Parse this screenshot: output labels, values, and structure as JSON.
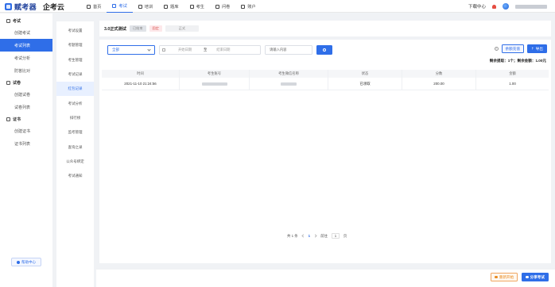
{
  "brand": {
    "logo_text": "赋考器",
    "sub_text": "企考云"
  },
  "nav": [
    {
      "label": "首页",
      "icon": "home-icon",
      "active": false
    },
    {
      "label": "考试",
      "icon": "exam-icon",
      "active": true
    },
    {
      "label": "培训",
      "icon": "training-icon",
      "active": false
    },
    {
      "label": "题库",
      "icon": "question-bank-icon",
      "active": false
    },
    {
      "label": "考生",
      "icon": "student-icon",
      "active": false
    },
    {
      "label": "问卷",
      "icon": "survey-icon",
      "active": false
    },
    {
      "label": "账户",
      "icon": "account-icon",
      "active": false
    }
  ],
  "topbar": {
    "download_label": "下载中心"
  },
  "sidebar": {
    "groups": [
      {
        "label": "考试",
        "icon": "exam-group-icon",
        "items": [
          "创建考试",
          "考试列表",
          "考试分析",
          "防答比对"
        ]
      },
      {
        "label": "试卷",
        "icon": "paper-group-icon",
        "items": [
          "创建试卷",
          "试卷列表"
        ]
      },
      {
        "label": "证书",
        "icon": "certificate-group-icon",
        "items": [
          "创建证书",
          "证书列表"
        ]
      }
    ],
    "active_item": "考试列表",
    "help_label": "帮助中心"
  },
  "sidebar2": {
    "items": [
      "考试设置",
      "考题管理",
      "考生管理",
      "考试记录",
      "红包记录",
      "考试分析",
      "排行榜",
      "监考管理",
      "查询之录",
      "公众号绑定",
      "考试通知"
    ],
    "active_item": "红包记录"
  },
  "exam_header": {
    "title": "3.0正式测试",
    "tags": [
      "已结束",
      "固定",
      "正式"
    ]
  },
  "filters": {
    "select_value": "全部",
    "start_placeholder": "开始日期",
    "to_label": "至",
    "end_placeholder": "结束日期",
    "keyword_placeholder": "请输入内容"
  },
  "actions": {
    "refill_label": "余额充值",
    "export_label": "导出"
  },
  "remain_text": "剩余提取：1个；剩余金额：1.00元",
  "table": {
    "columns": [
      "时间",
      "考生账号",
      "考生微信名称",
      "状态",
      "分数",
      "金额"
    ],
    "rows": [
      {
        "time": "2021-11-10 21:24:56",
        "account": "",
        "wechat": "",
        "status": "已领取",
        "score": "200.00",
        "amount": "1.00"
      }
    ]
  },
  "pagination": {
    "total_text": "共 1 条",
    "current_page": "1",
    "goto_label": "前往",
    "goto_value": "1",
    "page_suffix": "页"
  },
  "footer": {
    "restart_label": "重新开始",
    "share_label": "分享考试"
  },
  "colors": {
    "primary": "#2f6ee8",
    "orange": "#e8891f"
  }
}
